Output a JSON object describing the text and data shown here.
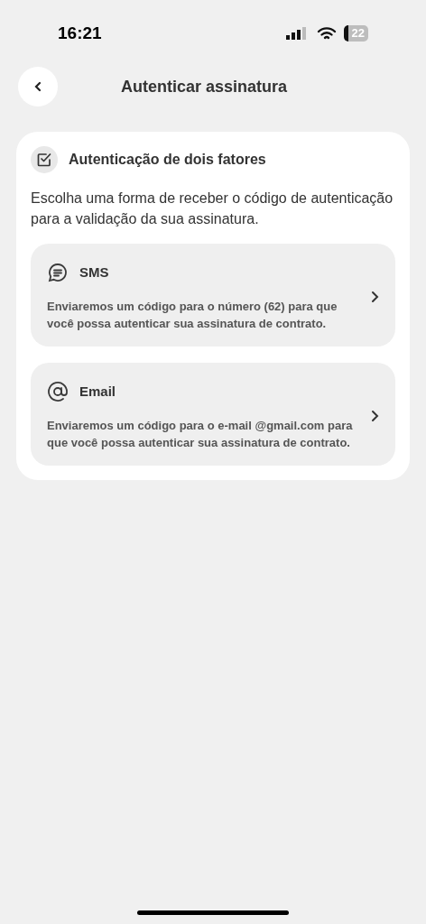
{
  "status_bar": {
    "time": "16:21",
    "battery": "22"
  },
  "header": {
    "title": "Autenticar assinatura"
  },
  "card": {
    "title": "Autenticação de dois fatores",
    "description": "Escolha uma forma de receber o código de autenticação para a validação da sua assinatura.",
    "options": [
      {
        "kind": "sms",
        "title": "SMS",
        "text": "Enviaremos um código para o número (62) para que você possa autenticar sua assinatura de contrato."
      },
      {
        "kind": "email",
        "title": "Email",
        "text": "Enviaremos um código para o e-mail @gmail.com para que você possa autenticar sua assinatura de contrato."
      }
    ]
  }
}
